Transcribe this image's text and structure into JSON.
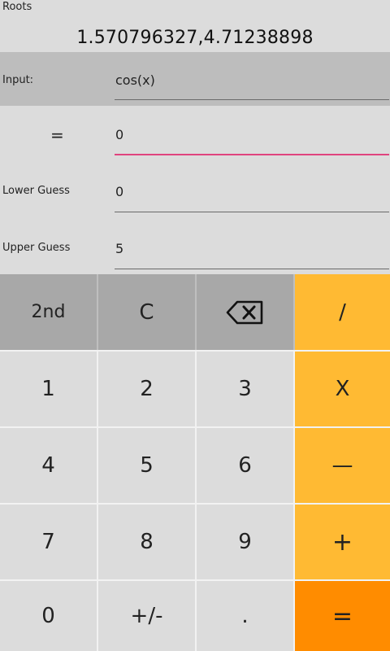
{
  "header": {
    "title": "Roots",
    "result": "1.570796327,4.71238898"
  },
  "form": {
    "input_label": "Input:",
    "input_value": "cos(x)",
    "equals_label": "=",
    "equals_value": "0",
    "lower_label": "Lower Guess",
    "lower_value": "0",
    "upper_label": "Upper Guess",
    "upper_value": "5"
  },
  "keypad": {
    "second": "2nd",
    "clear": "C",
    "backspace_icon": "backspace-icon",
    "divide": "/",
    "one": "1",
    "two": "2",
    "three": "3",
    "multiply": "X",
    "four": "4",
    "five": "5",
    "six": "6",
    "minus": "—",
    "seven": "7",
    "eight": "8",
    "nine": "9",
    "plus": "+",
    "zero": "0",
    "plus_minus": "+/-",
    "decimal": ".",
    "equals": "="
  },
  "colors": {
    "orange": "#ffba33",
    "orange_deep": "#ff8c00",
    "field_active": "#e0447e"
  }
}
